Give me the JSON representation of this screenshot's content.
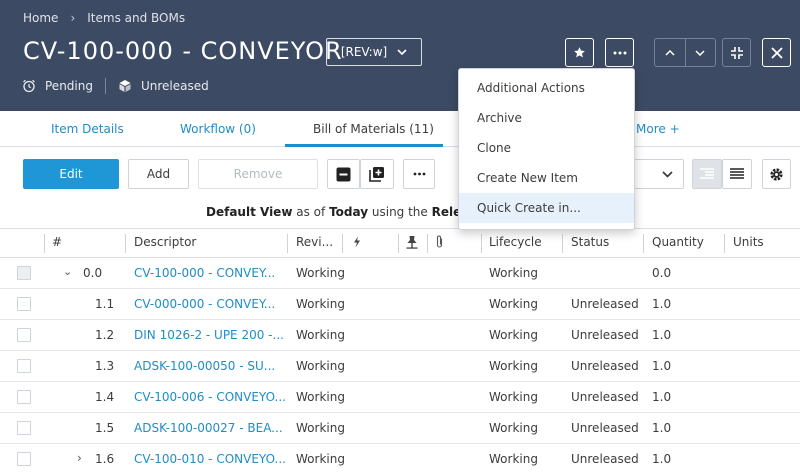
{
  "breadcrumb": [
    "Home",
    "Items and BOMs"
  ],
  "title": "CV-100-000 - CONVEYOR",
  "revision": "[REV:w]",
  "status": {
    "workflow": "Pending",
    "release": "Unreleased"
  },
  "tabs": [
    {
      "label": "Item Details"
    },
    {
      "label": "Workflow (0)"
    },
    {
      "label": "Bill of Materials (11)"
    },
    {
      "label": "More +"
    }
  ],
  "toolbar": {
    "edit": "Edit",
    "add": "Add",
    "remove": "Remove"
  },
  "view_line": {
    "view": "Default View",
    "as_of": "as of",
    "date": "Today",
    "using": "using the",
    "release": "Release"
  },
  "columns": {
    "num": "#",
    "descriptor": "Descriptor",
    "revision": "Revi...",
    "lifecycle": "Lifecycle",
    "status": "Status",
    "quantity": "Quantity",
    "units": "Units"
  },
  "rows": [
    {
      "num": "0.0",
      "descriptor": "CV-100-000 - CONVEY...",
      "revision": "Working",
      "lifecycle": "Working",
      "status": "",
      "quantity": "0.0"
    },
    {
      "num": "1.1",
      "descriptor": "CV-000-000 - CONVEY...",
      "revision": "Working",
      "lifecycle": "Working",
      "status": "Unreleased",
      "quantity": "1.0"
    },
    {
      "num": "1.2",
      "descriptor": "DIN 1026-2 - UPE 200 -...",
      "revision": "Working",
      "lifecycle": "Working",
      "status": "Unreleased",
      "quantity": "1.0"
    },
    {
      "num": "1.3",
      "descriptor": "ADSK-100-00050 - SU...",
      "revision": "Working",
      "lifecycle": "Working",
      "status": "Unreleased",
      "quantity": "1.0"
    },
    {
      "num": "1.4",
      "descriptor": "CV-100-006 - CONVEYO...",
      "revision": "Working",
      "lifecycle": "Working",
      "status": "Unreleased",
      "quantity": "1.0"
    },
    {
      "num": "1.5",
      "descriptor": "ADSK-100-00027 - BEA...",
      "revision": "Working",
      "lifecycle": "Working",
      "status": "Unreleased",
      "quantity": "1.0"
    },
    {
      "num": "1.6",
      "descriptor": "CV-100-010 - CONVEYO...",
      "revision": "Working",
      "lifecycle": "Working",
      "status": "Unreleased",
      "quantity": "1.0"
    }
  ],
  "menu": [
    "Additional Actions",
    "Archive",
    "Clone",
    "Create New Item",
    "Quick Create in..."
  ],
  "icons": {
    "workflow": "alarm-clock-icon",
    "release": "cube-icon",
    "favorite": "star-icon",
    "more": "ellipsis-icon",
    "collapse": "collapse-icon",
    "close": "close-icon"
  },
  "colors": {
    "header": "#3c4a63",
    "accent": "#1f96d6",
    "link": "#1f8dc6",
    "menu_highlight": "#e6f1fb"
  }
}
